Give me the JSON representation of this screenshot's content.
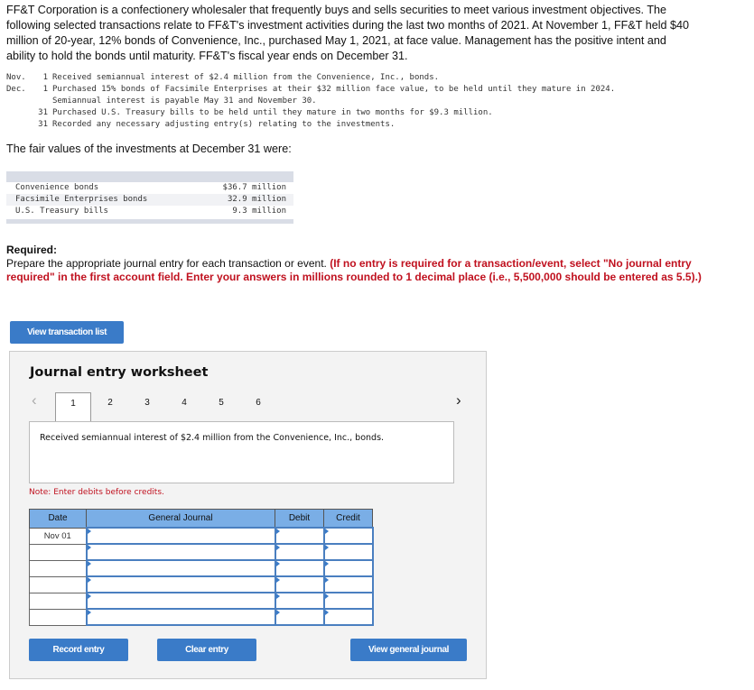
{
  "intro": "FF&T Corporation is a confectionery wholesaler that frequently buys and sells securities to meet various investment objectives. The following selected transactions relate to FF&T's investment activities during the last two months of 2021. At November 1, FF&T held $40 million of 20-year, 12% bonds of Convenience, Inc., purchased May 1, 2021, at face value. Management has the positive intent and ability to hold the bonds until maturity. FF&T's fiscal year ends on December 31.",
  "transactions": [
    {
      "month": "Nov.",
      "day": "1",
      "text": "Received semiannual interest of $2.4 million from the Convenience, Inc., bonds."
    },
    {
      "month": "Dec.",
      "day": "1",
      "text": "Purchased 15% bonds of Facsimile Enterprises at their $32 million face value, to be held until they mature in 2024."
    },
    {
      "month": "",
      "day": "",
      "text": "Semiannual interest is payable May 31 and November 30."
    },
    {
      "month": "",
      "day": "31",
      "text": "Purchased U.S. Treasury bills to be held until they mature in two months for $9.3 million."
    },
    {
      "month": "",
      "day": "31",
      "text": "Recorded any necessary adjusting entry(s) relating to the investments."
    }
  ],
  "fair_value_label": "The fair values of the investments at December 31 were:",
  "fair_values": [
    {
      "name": "Convenience bonds",
      "value": "$36.7 million"
    },
    {
      "name": "Facsimile Enterprises bonds",
      "value": "32.9 million"
    },
    {
      "name": "U.S. Treasury bills",
      "value": "9.3 million"
    }
  ],
  "required": {
    "heading": "Required:",
    "text": "Prepare the appropriate journal entry for each transaction or event. ",
    "instruction": "(If no entry is required for a transaction/event, select \"No journal entry required\" in the first account field. Enter your answers in millions rounded to 1 decimal place (i.e., 5,500,000 should be entered as 5.5).)"
  },
  "view_transaction_list": "View transaction list",
  "worksheet": {
    "title": "Journal entry worksheet",
    "tabs": [
      "1",
      "2",
      "3",
      "4",
      "5",
      "6"
    ],
    "active_tab": "1",
    "description": "Received semiannual interest of $2.4 million from the Convenience, Inc., bonds.",
    "note": "Note: Enter debits before credits.",
    "columns": [
      "Date",
      "General Journal",
      "Debit",
      "Credit"
    ],
    "rows": [
      {
        "date": "Nov 01"
      },
      {
        "date": ""
      },
      {
        "date": ""
      },
      {
        "date": ""
      },
      {
        "date": ""
      },
      {
        "date": ""
      }
    ],
    "record_entry": "Record entry",
    "clear_entry": "Clear entry",
    "view_general_journal": "View general journal"
  },
  "colors": {
    "button": "#3a7bc8",
    "header": "#7aaee6",
    "note": "#c0111f"
  }
}
